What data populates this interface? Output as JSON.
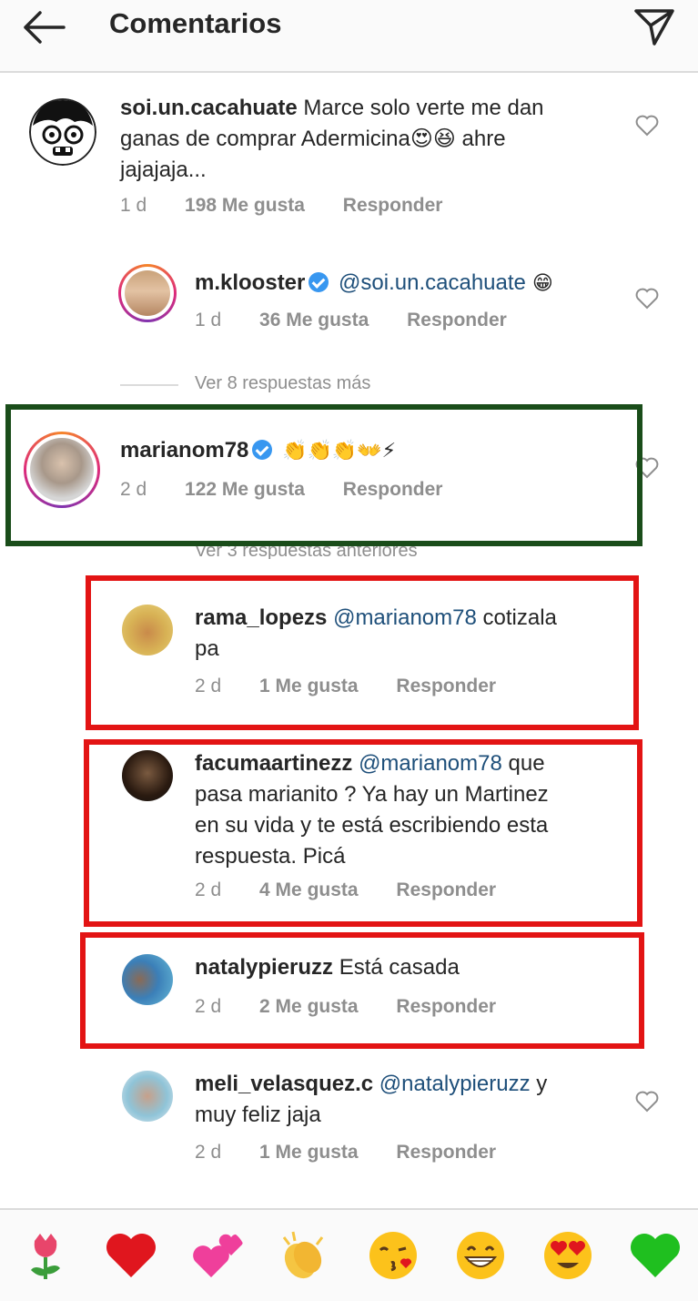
{
  "header": {
    "title": "Comentarios",
    "back_icon": "arrow-left-icon",
    "send_icon": "paper-plane-icon"
  },
  "comments": [
    {
      "user": "soi.un.cacahuate",
      "text_lines": [
        "Marce solo verte me dan",
        "ganas de comprar Adermicina😍😆 ahre",
        "jajajaja..."
      ],
      "time": "1 d",
      "likes": "198 Me gusta",
      "reply": "Responder"
    },
    {
      "user": "m.klooster",
      "mention": "@soi.un.cacahuate",
      "text": " 😁",
      "time": "1 d",
      "likes": "36 Me gusta",
      "reply": "Responder"
    },
    {
      "user": "marianom78",
      "text": "👏👏👏👐⚡",
      "time": "2 d",
      "likes": "122 Me gusta",
      "reply": "Responder"
    },
    {
      "user": "rama_lopezs",
      "mention": "@marianom78",
      "text_lines": [
        " cotizala",
        "pa"
      ],
      "time": "2 d",
      "likes": "1 Me gusta",
      "reply": "Responder"
    },
    {
      "user": "facumaartinezz",
      "mention": "@marianom78",
      "text_lines": [
        " que",
        "pasa marianito ? Ya hay un Martinez",
        "en su vida y te está escribiendo esta",
        "respuesta. Picá"
      ],
      "time": "2 d",
      "likes": "4 Me gusta",
      "reply": "Responder"
    },
    {
      "user": "natalypieruzz",
      "text": " Está casada",
      "time": "2 d",
      "likes": "2 Me gusta",
      "reply": "Responder"
    },
    {
      "user": "meli_velasquez.c",
      "mention": "@natalypieruzz",
      "text_lines": [
        " y",
        "muy feliz jaja"
      ],
      "time": "2 d",
      "likes": "1 Me gusta",
      "reply": "Responder"
    }
  ],
  "more_replies": {
    "more": "Ver 8 respuestas más",
    "previous": "Ver 3 respuestas anteriores"
  },
  "emoji_bar": [
    "🌷",
    "❤️",
    "💕",
    "👏",
    "😘",
    "😁",
    "😍",
    "💚"
  ],
  "colors": {
    "mention": "#1e4f7a",
    "muted": "#8e8e8e",
    "green_box": "#1a4d1a",
    "red_box": "#e31414",
    "verified": "#3897f0"
  }
}
